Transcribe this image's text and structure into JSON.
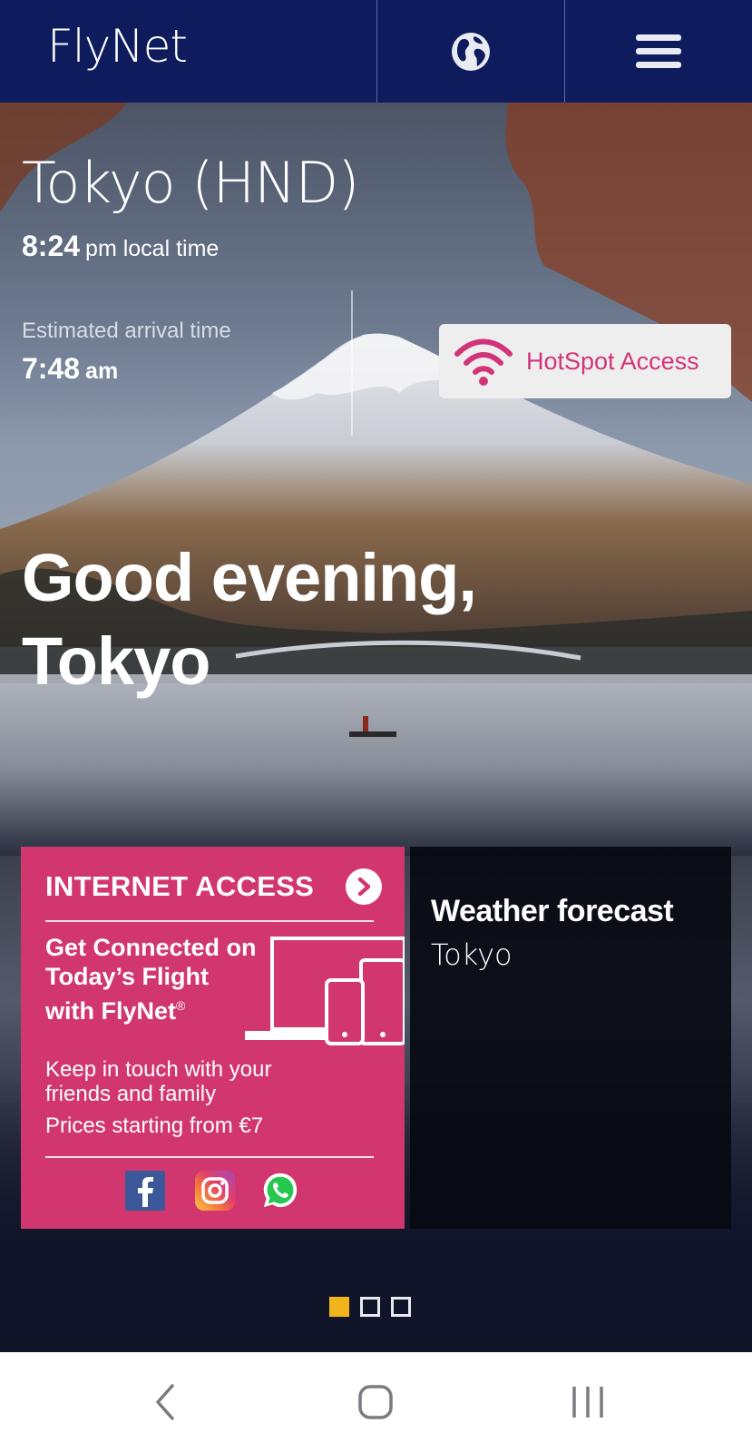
{
  "header": {
    "logo": "FlyNet",
    "globe_icon": "globe-icon",
    "menu_icon": "hamburger-menu-icon"
  },
  "destination": {
    "city": "Tokyo (HND)",
    "local_time": "8:24",
    "local_time_suffix": "pm local time",
    "eta_label": "Estimated arrival time",
    "eta_time": "7:48",
    "eta_suffix": "am"
  },
  "hotspot": {
    "label": "HotSpot Access",
    "icon": "wifi-icon"
  },
  "greeting": {
    "line1": "Good evening,",
    "line2": "Tokyo"
  },
  "internet_card": {
    "title": "INTERNET ACCESS",
    "headline": "Get Connected on Today’s Flight with FlyNet",
    "registered": "®",
    "body": "Keep in touch with your friends and family",
    "price": "Prices starting from €7",
    "social": [
      "facebook-icon",
      "instagram-icon",
      "whatsapp-icon"
    ]
  },
  "weather_card": {
    "title": "Weather forecast",
    "city": "Tokyo"
  },
  "carousel": {
    "pages": 3,
    "active_index": 0
  },
  "colors": {
    "header_bg": "#0e1c5e",
    "accent_pink": "#d2366f",
    "indicator_active": "#f3b31c"
  },
  "nav_bar": {
    "back": "back-icon",
    "home": "home-icon",
    "recents": "recents-icon"
  }
}
